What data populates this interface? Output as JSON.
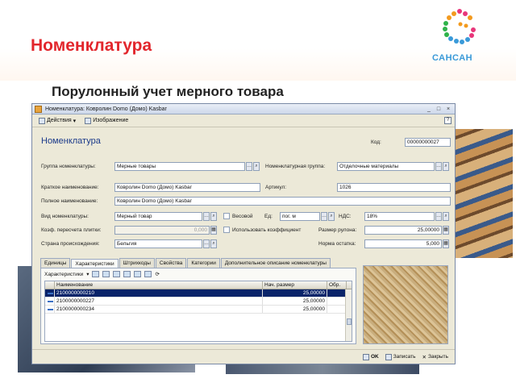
{
  "slide": {
    "title": "Номенклатура",
    "subtitle": "Порулонный учет мерного товара",
    "logo_text": "САНСАН",
    "brand_colors": {
      "title_red": "#e2262c",
      "logo_blue": "#3a9ad9",
      "logo_green": "#2fb34a",
      "logo_orange": "#f39a1e",
      "logo_pink": "#e8367a"
    }
  },
  "window": {
    "title": "Номенклатура: Ковролин Domo (Домо) Kasbar",
    "controls": [
      "_",
      "□",
      "×"
    ],
    "toolbar": {
      "actions_label": "Действия",
      "image_label": "Изображение",
      "help_label": "?"
    },
    "heading": "Номенклатура",
    "code_label": "Код:",
    "code_value": "00000000027",
    "fields": {
      "group_label": "Группа номенклатуры:",
      "group_value": "Мерные товары",
      "nom_group_label": "Номенклатурная группа:",
      "nom_group_value": "Отделочные материалы",
      "short_name_label": "Краткое наименование:",
      "short_name_value": "Ковролин Domo (Домо) Kasbar",
      "article_label": "Артикул:",
      "article_value": "1026",
      "full_name_label": "Полное наименование:",
      "full_name_value": "Ковролин Domo (Домо) Kasbar",
      "kind_label": "Вид номенклатуры:",
      "kind_value": "Мерный товар",
      "weight_label": "Весовой",
      "unit_label": "Ед:",
      "unit_value": "пог. м",
      "vat_label": "НДС:",
      "vat_value": "18%",
      "coef_label": "Коэф. пересчета плитки:",
      "coef_value": "0,000",
      "use_coef_label": "Использовать коэффициент",
      "roll_size_label": "Размер рулона:",
      "roll_size_value": "25,00000",
      "country_label": "Страна происхождения:",
      "country_value": "Бельгия",
      "min_stock_label": "Норма остатка:",
      "min_stock_value": "5,000"
    },
    "tabs": [
      "Единицы",
      "Характеристики",
      "Штрихкоды",
      "Свойства",
      "Категории",
      "Дополнительное описание номенклатуры"
    ],
    "active_tab": "Характеристики",
    "panel_toolbar_label": "Характеристики",
    "grid": {
      "columns": [
        "Наименование",
        "Нач. размер",
        "Обр."
      ],
      "rows": [
        {
          "name": "2100000000210",
          "size": "25,00000",
          "obr": ""
        },
        {
          "name": "2100000000227",
          "size": "25,00000",
          "obr": ""
        },
        {
          "name": "2100000000234",
          "size": "25,00000",
          "obr": ""
        }
      ]
    },
    "buttons": {
      "ok": "OK",
      "save": "Записать",
      "close": "Закрыть"
    }
  }
}
